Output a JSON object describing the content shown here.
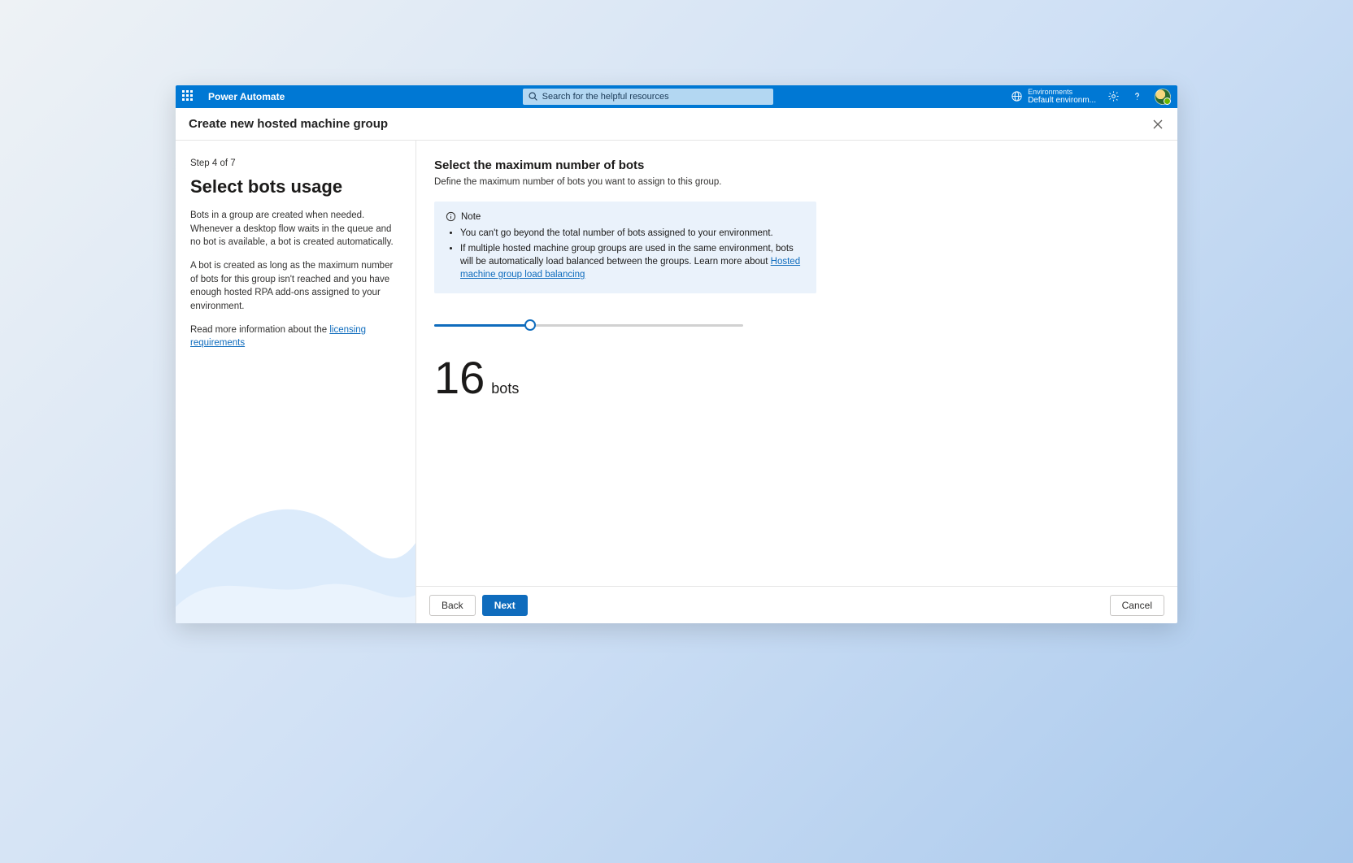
{
  "topbar": {
    "app_name": "Power Automate",
    "search_placeholder": "Search for the helpful resources",
    "env_label": "Environments",
    "env_name": "Default environm..."
  },
  "panel": {
    "title": "Create new hosted machine group"
  },
  "left": {
    "step_label": "Step 4 of 7",
    "heading": "Select bots usage",
    "para1": "Bots in a group are created when needed. Whenever a desktop flow waits in the queue and no bot is available, a bot is created automatically.",
    "para2": "A bot is created as long as the maximum number of bots for this group isn't reached and you have enough hosted RPA add-ons assigned to your environment.",
    "para3_prefix": "Read more information about the ",
    "para3_link": "licensing requirements"
  },
  "main": {
    "title": "Select the maximum number of bots",
    "desc": "Define the maximum number of bots you want to assign to this group.",
    "note_label": "Note",
    "note_item1": "You can't go beyond the total number of bots assigned to your environment.",
    "note_item2_prefix": "If multiple hosted machine group groups are used in the same environment, bots will be automatically load balanced between the groups. Learn more about ",
    "note_item2_link": "Hosted machine group load balancing",
    "slider_value": "16",
    "slider_unit": "bots"
  },
  "footer": {
    "back": "Back",
    "next": "Next",
    "cancel": "Cancel"
  }
}
